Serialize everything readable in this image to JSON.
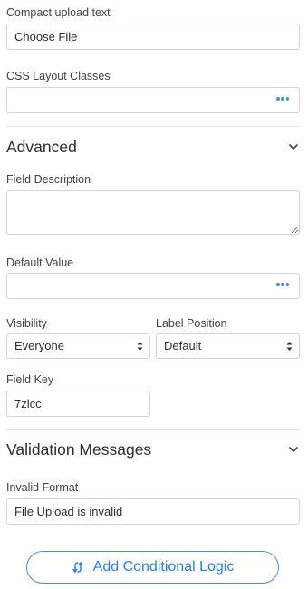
{
  "compact_upload": {
    "label": "Compact upload text",
    "value": "Choose File"
  },
  "css_layout": {
    "label": "CSS Layout Classes",
    "value": "",
    "dots_icon": "more-dots-icon"
  },
  "advanced": {
    "title": "Advanced",
    "chevron_icon": "chevron-down-icon"
  },
  "field_description": {
    "label": "Field Description",
    "value": ""
  },
  "default_value": {
    "label": "Default Value",
    "value": "",
    "dots_icon": "more-dots-icon"
  },
  "visibility": {
    "label": "Visibility",
    "selected": "Everyone"
  },
  "label_position": {
    "label": "Label Position",
    "selected": "Default"
  },
  "field_key": {
    "label": "Field Key",
    "value": "7zlcc"
  },
  "validation": {
    "title": "Validation Messages",
    "chevron_icon": "chevron-down-icon"
  },
  "invalid_format": {
    "label": "Invalid Format",
    "value": "File Upload is invalid"
  },
  "conditional_logic": {
    "label": "Add Conditional Logic",
    "icon": "conditional-branch-icon"
  },
  "colors": {
    "accent": "#4a90e2",
    "text": "#3c434a",
    "border": "#d0d5db"
  }
}
